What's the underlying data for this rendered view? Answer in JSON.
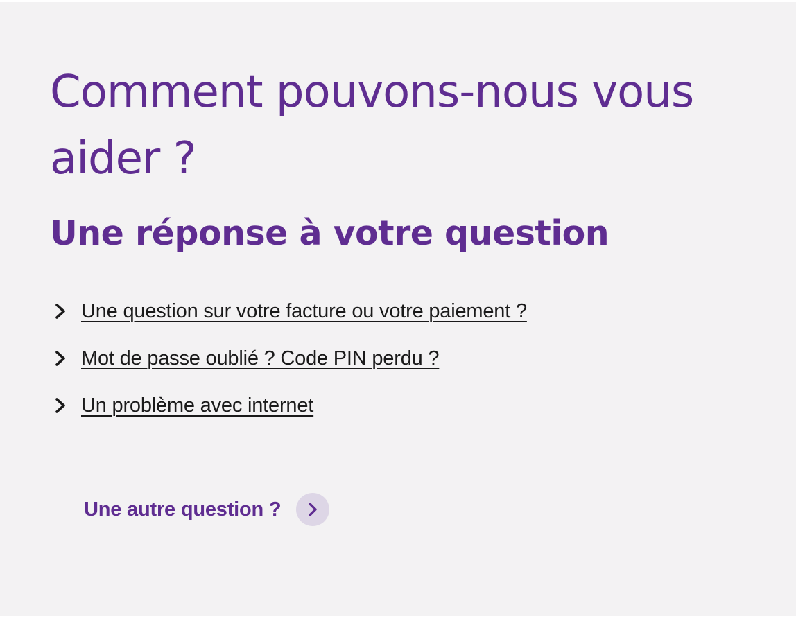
{
  "heading": {
    "title": "Comment pouvons-nous vous aider ?",
    "subtitle": "Une réponse à votre question"
  },
  "faq": {
    "items": [
      {
        "label": "Une question sur votre facture ou votre paiement ?",
        "icon": "chevron-right-icon"
      },
      {
        "label": "Mot de passe oublié ? Code PIN perdu ?",
        "icon": "chevron-right-icon"
      },
      {
        "label": "Un problème avec internet",
        "icon": "chevron-right-icon"
      }
    ]
  },
  "other": {
    "label": "Une autre question ?",
    "icon": "chevron-right-icon"
  },
  "colors": {
    "brand_purple": "#5f2d91",
    "background": "#f3f2f3",
    "link_text": "#1a1a1a",
    "circle_button": "#ddd6e6"
  }
}
